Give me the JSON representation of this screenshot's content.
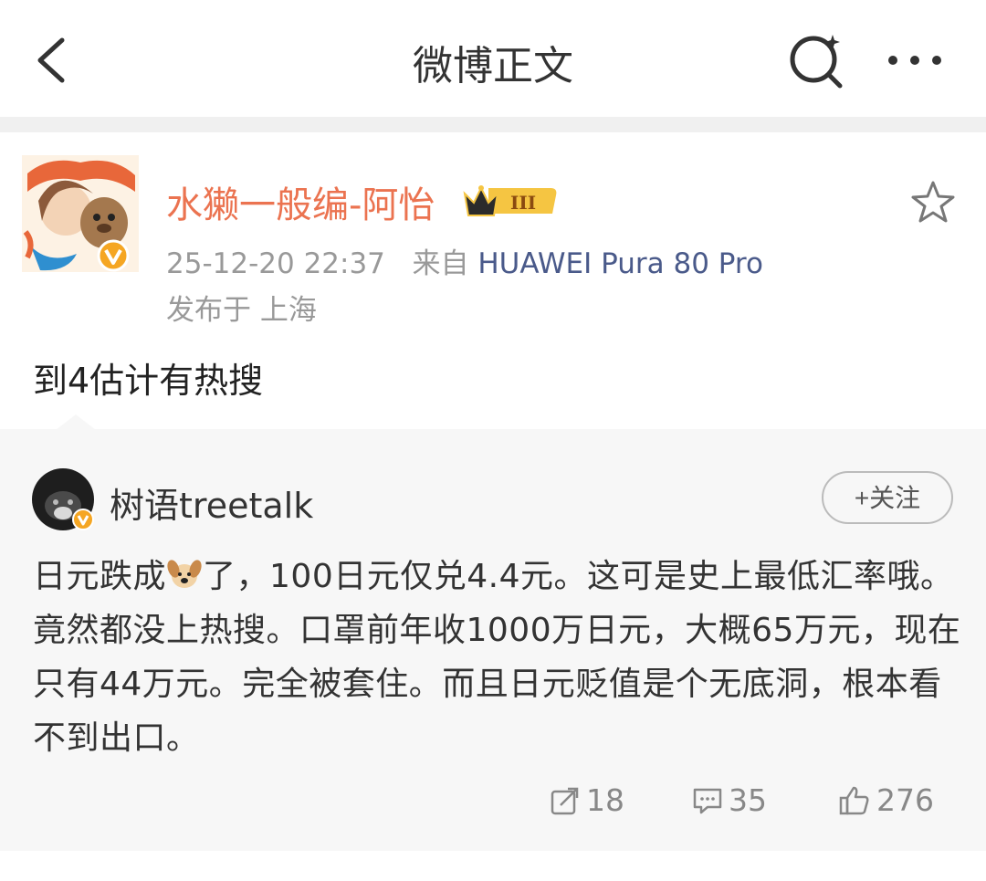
{
  "header": {
    "title": "微博正文"
  },
  "post": {
    "author": "水獭一般编-阿怡",
    "badge_level": "III",
    "timestamp": "25-12-20 22:37",
    "source_prefix": "来自",
    "source": "HUAWEI Pura 80 Pro",
    "location": "发布于 上海",
    "text": "到4估计有热搜"
  },
  "repost": {
    "author": "树语treetalk",
    "follow_label": "+关注",
    "text_part1": "日元跌成",
    "emoji": "dog",
    "text_part2": "了，100日元仅兑4.4元。这可是史上最低汇率哦。竟然都没上热搜。口罩前年收1000万日元，大概65万元，现在只有44万元。完全被套住。而且日元贬值是个无底洞，根本看不到出口。",
    "stats": {
      "reposts": "18",
      "comments": "35",
      "likes": "276"
    }
  },
  "colors": {
    "author": "#eb7350",
    "source": "#4a5a8a",
    "verified": "#f5a623"
  }
}
